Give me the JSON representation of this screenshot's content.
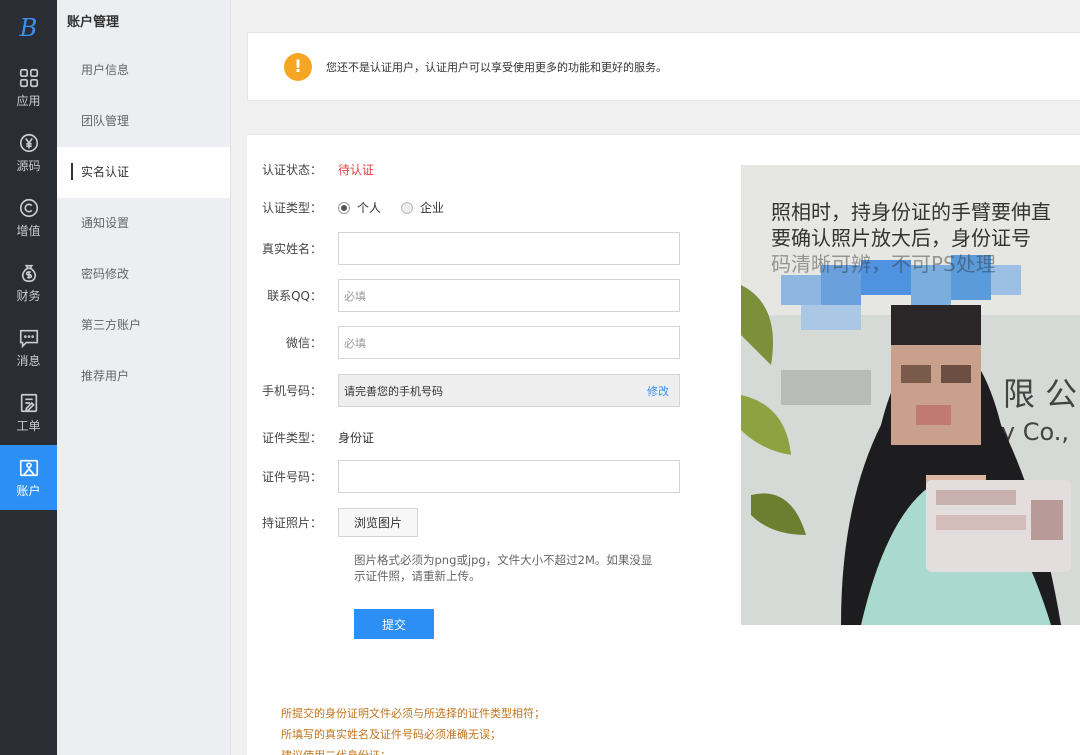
{
  "rail": {
    "logo": "B",
    "items": [
      {
        "label": "应用",
        "icon": "apps-icon"
      },
      {
        "label": "源码",
        "icon": "yuan-coin-icon"
      },
      {
        "label": "增值",
        "icon": "copyright-icon"
      },
      {
        "label": "财务",
        "icon": "money-bag-icon"
      },
      {
        "label": "消息",
        "icon": "message-icon"
      },
      {
        "label": "工单",
        "icon": "ticket-icon"
      },
      {
        "label": "账户",
        "icon": "account-icon"
      }
    ]
  },
  "subnav": {
    "title": "账户管理",
    "items": [
      "用户信息",
      "团队管理",
      "实名认证",
      "通知设置",
      "密码修改",
      "第三方账户",
      "推荐用户"
    ]
  },
  "notice": {
    "icon": "warning-icon",
    "mark": "!",
    "message": "您还不是认证用户，认证用户可以享受使用更多的功能和更好的服务。"
  },
  "form": {
    "status_label": "认证状态：",
    "status_value": "待认证",
    "type_label": "认证类型：",
    "type_options": [
      "个人",
      "企业"
    ],
    "name_label": "真实姓名：",
    "name_value": "",
    "qq_label": "联系QQ：",
    "qq_placeholder": "必填",
    "wechat_label": "微信：",
    "wechat_placeholder": "必填",
    "phone_label": "手机号码：",
    "phone_value": "请完善您的手机号码",
    "phone_edit": "修改",
    "idtype_label": "证件类型：",
    "idtype_value": "身份证",
    "idno_label": "证件号码：",
    "idno_value": "",
    "photo_label": "持证照片：",
    "browse_button": "浏览图片",
    "hint": "图片格式必须为png或jpg，文件大小不超过2M。如果没显示证件照，请重新上传。",
    "submit_button": "提交"
  },
  "photo": {
    "caption_line1": "照相时，持身份证的手臂要伸直",
    "caption_line2": "要确认照片放大后，身份证号",
    "caption_line3": "码清晰可辨，不可PS处理",
    "wall_text_right": "限 公",
    "wall_text_right2": "ogy Co.,"
  },
  "notes": [
    "所提交的身份证明文件必须与所选择的证件类型相符；",
    "所填写的真实姓名及证件号码必须准确无误；",
    "建议使用二代身份证；"
  ]
}
